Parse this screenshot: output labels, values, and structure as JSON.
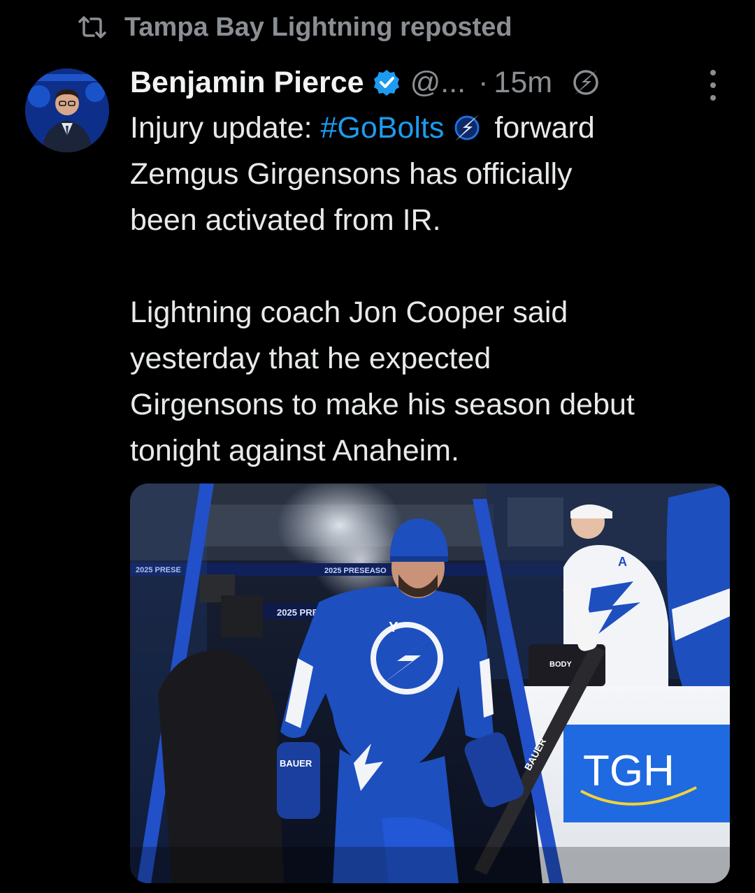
{
  "repost": {
    "icon": "repost-icon",
    "text": "Tampa Bay Lightning reposted"
  },
  "tweet": {
    "author_name": "Benjamin Pierce",
    "handle": "@...",
    "separator": "·",
    "time": "15m",
    "verified_icon": "verified-badge-icon",
    "more_icon": "more-vertical-icon",
    "body": {
      "line1_prefix": "Injury update: ",
      "hashtag": "#GoBolts",
      "line1_suffix": "forward",
      "line2": "Zemgus Girgensons has officially",
      "line3": "been activated from IR.",
      "line4": "Lightning coach Jon Cooper said",
      "line5": "yesterday that he expected",
      "line6": "Girgensons to make his season debut",
      "line7": "tonight against Anaheim."
    }
  },
  "media": {
    "banner_text_1": "2025 PRESEASO",
    "banner_text_2": "2025 PRE",
    "banner_text_3": "2025 PRESE",
    "board_ad_text": "TGH",
    "stick_brand": "BAUER",
    "glove_brand": "BAUER",
    "water_carrier_text": "BODY",
    "letter_A": "A"
  },
  "colors": {
    "background": "#000000",
    "text_primary": "#e7e9ea",
    "text_secondary": "#8b8f94",
    "link": "#1d9bf0",
    "lightning_blue": "#1e4fbf"
  }
}
